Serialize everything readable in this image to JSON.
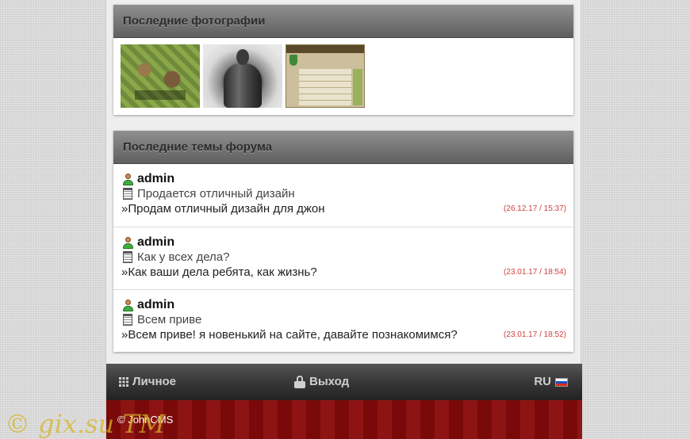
{
  "photos_section": {
    "title": "Последние фотографии",
    "thumbnails": [
      "photo-thumbnail-village",
      "photo-thumbnail-bodybuilder",
      "photo-thumbnail-game-ranking"
    ]
  },
  "forum_section": {
    "title": "Последние темы форума",
    "topics": [
      {
        "author": "admin",
        "title": "Продается отличный дизайн",
        "snippet": "»Продам отличный дизайн для джон",
        "date": "(26.12.17 / 15:37)"
      },
      {
        "author": "admin",
        "title": "Как у всех дела?",
        "snippet": "»Как ваши дела ребята, как жизнь?",
        "date": "(23.01.17 / 18:54)"
      },
      {
        "author": "admin",
        "title": "Всем приве",
        "snippet": "»Всем приве! я новенький на сайте, давайте познакомимся?",
        "date": "(23.01.17 / 18:52)"
      }
    ]
  },
  "navbar": {
    "personal_label": "Личное",
    "logout_label": "Выход",
    "language_label": "RU"
  },
  "footer": {
    "copyright": "© JohnCMS"
  },
  "watermark": "© gix.su TM",
  "colors": {
    "date_red": "#d04040",
    "footer_red": "#7a0a0a",
    "header_grey": "#7a7a7a"
  }
}
